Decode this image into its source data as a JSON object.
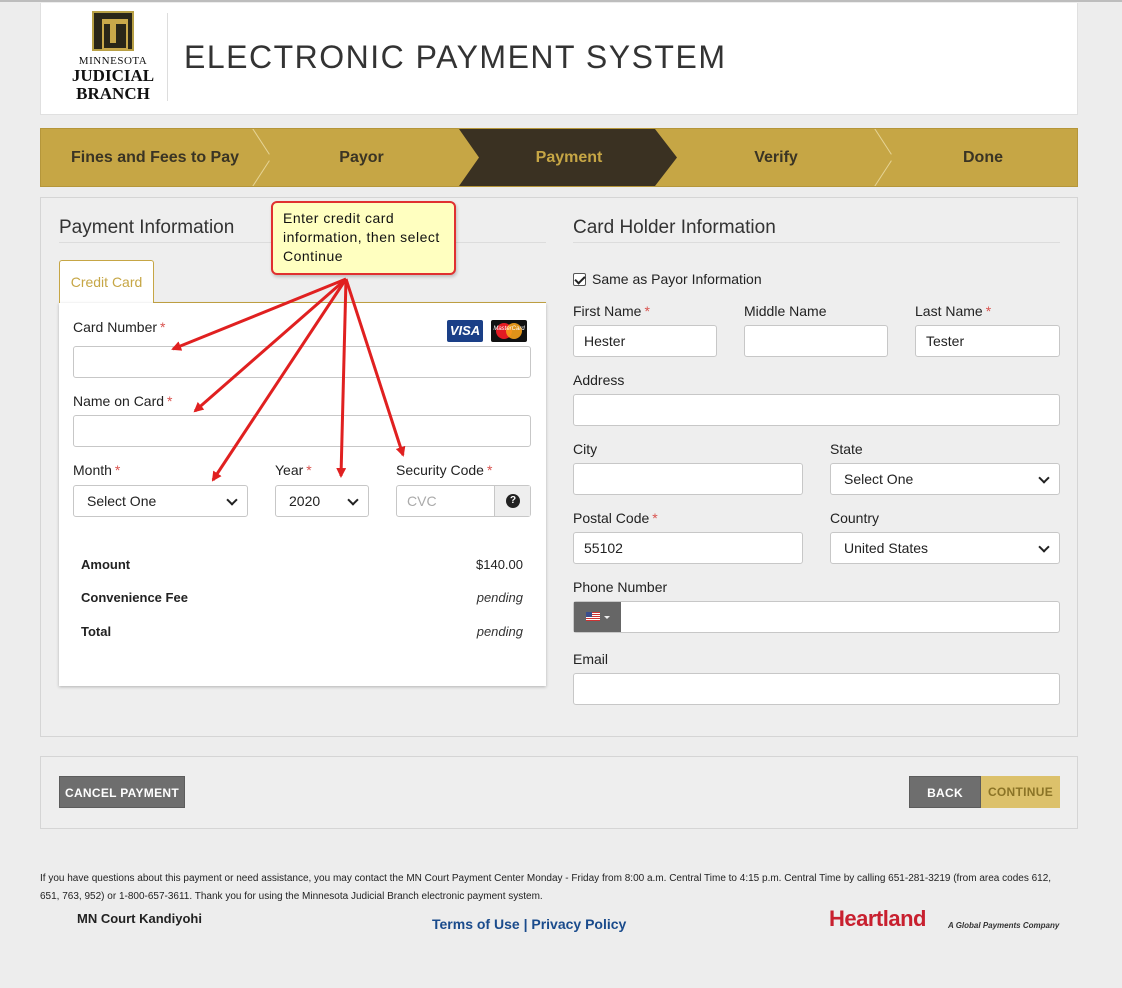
{
  "header": {
    "logo_line1": "MINNESOTA",
    "logo_line2": "JUDICIAL",
    "logo_line3": "BRANCH",
    "site_title": "ELECTRONIC PAYMENT SYSTEM"
  },
  "steps": [
    {
      "label": "Fines and Fees to Pay",
      "active": false
    },
    {
      "label": "Payor",
      "active": false
    },
    {
      "label": "Payment",
      "active": true
    },
    {
      "label": "Verify",
      "active": false
    },
    {
      "label": "Done",
      "active": false
    }
  ],
  "payment": {
    "title": "Payment Information",
    "tab": "Credit Card",
    "card_number_label": "Card Number",
    "card_number_value": "",
    "name_on_card_label": "Name on Card",
    "name_on_card_value": "",
    "month_label": "Month",
    "month_value": "Select One",
    "year_label": "Year",
    "year_value": "2020",
    "security_code_label": "Security Code",
    "security_code_placeholder": "CVC",
    "help_icon": "?",
    "card_brands": [
      "VISA",
      "MasterCard"
    ],
    "summary": [
      {
        "label": "Amount",
        "value": "$140.00"
      },
      {
        "label": "Convenience Fee",
        "value": "pending"
      },
      {
        "label": "Total",
        "value": "pending"
      }
    ],
    "required_mark": "*"
  },
  "cardholder": {
    "title": "Card Holder Information",
    "same_as_payor_label": "Same as Payor Information",
    "same_as_payor_checked": true,
    "first_name_label": "First Name",
    "first_name_value": "Hester",
    "middle_name_label": "Middle Name",
    "middle_name_value": "",
    "last_name_label": "Last Name",
    "last_name_value": "Tester",
    "address_label": "Address",
    "address_value": "",
    "city_label": "City",
    "city_value": "",
    "state_label": "State",
    "state_value": "Select One",
    "postal_label": "Postal Code",
    "postal_value": "55102",
    "country_label": "Country",
    "country_value": "United States",
    "phone_label": "Phone Number",
    "phone_value": "",
    "email_label": "Email",
    "email_value": ""
  },
  "actions": {
    "cancel": "CANCEL PAYMENT",
    "back": "BACK",
    "continue": "CONTINUE"
  },
  "footer": {
    "text": "If you have questions about this payment or need assistance, you may contact the MN Court Payment Center Monday - Friday from 8:00 a.m. Central Time to 4:15 p.m. Central Time by calling 651-281-3219 (from area codes 612, 651, 763, 952) or 1-800-657-3611. Thank you for using the Minnesota Judicial Branch electronic payment system.",
    "court": "MN Court Kandiyohi",
    "terms": "Terms of Use",
    "separator": "|",
    "privacy": "Privacy Policy",
    "provider": "Heartland",
    "provider_tagline": "A Global Payments Company"
  },
  "annotation": {
    "callout_text": "Enter credit card information, then select Continue",
    "color": "#e02020"
  }
}
